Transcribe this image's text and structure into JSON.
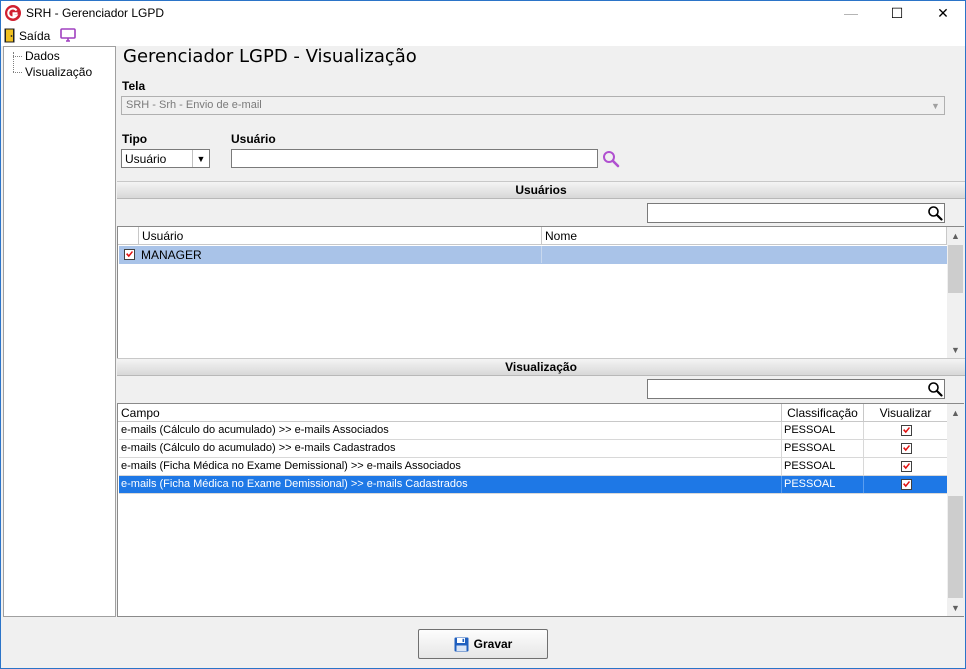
{
  "window": {
    "title": "SRH - Gerenciador LGPD",
    "minimize_glyph": "—",
    "maximize_glyph": "☐",
    "close_glyph": "✕"
  },
  "menu": {
    "exit_label": "Saída"
  },
  "tree": {
    "items": [
      "Dados",
      "Visualização"
    ]
  },
  "page": {
    "title": "Gerenciador LGPD - Visualização"
  },
  "form": {
    "tela_label": "Tela",
    "tela_value": "SRH - Srh - Envio de e-mail",
    "tipo_label": "Tipo",
    "tipo_value": "Usuário",
    "usuario_label": "Usuário",
    "usuario_value": ""
  },
  "users_section": {
    "header": "Usuários",
    "search_value": "",
    "columns": [
      "Usuário",
      "Nome"
    ],
    "rows": [
      {
        "checked": true,
        "usuario": "MANAGER",
        "nome": ""
      }
    ]
  },
  "vis_section": {
    "header": "Visualização",
    "search_value": "",
    "columns": [
      "Campo",
      "Classificação",
      "Visualizar"
    ],
    "rows": [
      {
        "campo": "e-mails (Cálculo do acumulado)  >> e-mails Associados",
        "classificacao": "PESSOAL",
        "visualizar": true,
        "selected": false
      },
      {
        "campo": "e-mails (Cálculo do acumulado)  >> e-mails Cadastrados",
        "classificacao": "PESSOAL",
        "visualizar": true,
        "selected": false
      },
      {
        "campo": "e-mails (Ficha Médica no Exame Demissional) >> e-mails Associados",
        "classificacao": "PESSOAL",
        "visualizar": true,
        "selected": false
      },
      {
        "campo": "e-mails (Ficha Médica no Exame Demissional) >> e-mails Cadastrados",
        "classificacao": "PESSOAL",
        "visualizar": true,
        "selected": true
      }
    ]
  },
  "footer": {
    "save_label": "Gravar"
  },
  "colors": {
    "selection_blue": "#1e78e6",
    "row_highlight": "#a9c3e8",
    "check_red": "#e01010",
    "accent_purple": "#a040c0"
  },
  "icons": [
    "app-logo-icon",
    "door-exit-icon",
    "monitor-icon",
    "search-icon",
    "floppy-disk-icon"
  ]
}
